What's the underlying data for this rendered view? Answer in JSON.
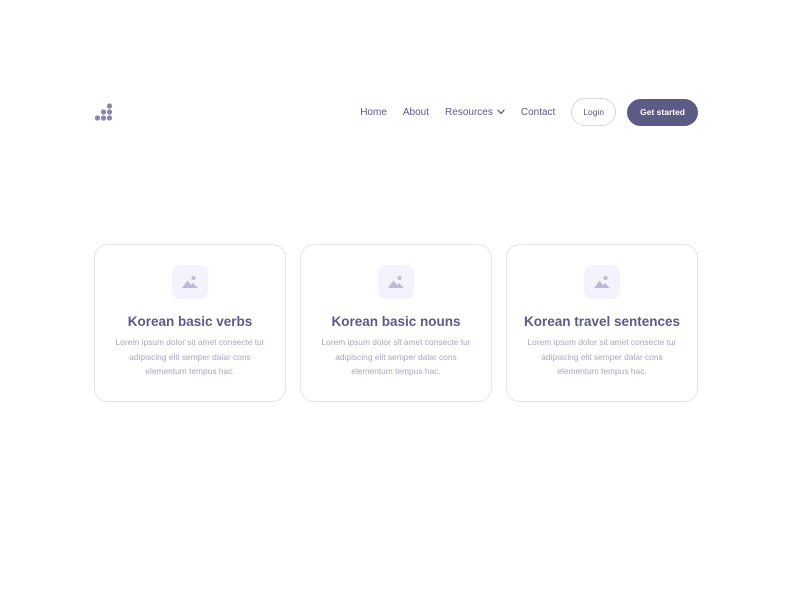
{
  "header": {
    "logo_icon": "dots-logo-icon",
    "nav": [
      {
        "label": "Home"
      },
      {
        "label": "About"
      },
      {
        "label": "Resources",
        "icon": "chevron-down-icon"
      },
      {
        "label": "Contact"
      }
    ],
    "login_label": "Login",
    "cta_label": "Get started"
  },
  "cards": [
    {
      "icon": "image-placeholder-icon",
      "title": "Korean basic verbs",
      "text": "Lorem ipsum dolor sit amet consecte tur adipiscing elit semper dalar cons elementum tempus hac."
    },
    {
      "icon": "image-placeholder-icon",
      "title": "Korean basic nouns",
      "text": "Lorem ipsum dolor sit amet consecte tur adipiscing elit semper dalar cons elementum tempus hac."
    },
    {
      "icon": "image-placeholder-icon",
      "title": "Korean travel sentences",
      "text": "Lorem ipsum dolor sit amet consecte tur adipiscing elit semper dalar cons elementum tempus hac."
    }
  ],
  "colors": {
    "primary": "#5e5a86",
    "muted_text": "#a9a7c0",
    "card_border": "#e4e3ee",
    "icon_bg": "#f4f3fb"
  }
}
